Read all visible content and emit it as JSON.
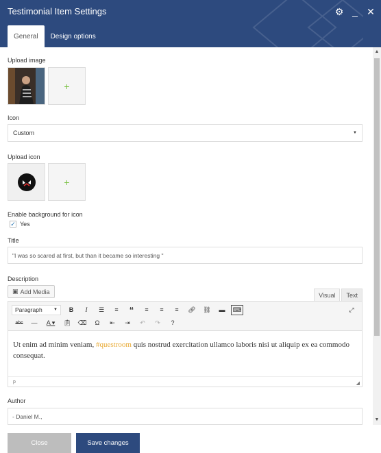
{
  "window": {
    "title": "Testimonial Item Settings"
  },
  "tabs": [
    {
      "label": "General"
    },
    {
      "label": "Design options"
    }
  ],
  "form": {
    "upload_image_label": "Upload image",
    "icon_label": "Icon",
    "icon_value": "Custom",
    "upload_icon_label": "Upload icon",
    "enable_bg_label": "Enable background for icon",
    "yes_label": "Yes",
    "title_label": "Title",
    "title_value": "\"I was so scared at first, but than it became so interesting \"",
    "description_label": "Description",
    "add_media_label": "Add Media",
    "visual_tab": "Visual",
    "text_tab": "Text",
    "paragraph_label": "Paragraph",
    "body_before": "Ut enim ad minim veniam, ",
    "body_hashtag": "#questroom",
    "body_after": " quis nostrud exercitation ullamco laboris nisi ut aliquip ex ea commodo consequat.",
    "status_path": "p",
    "author_label": "Author",
    "author_value": "- Daniel M.,"
  },
  "footer": {
    "close_label": "Close",
    "save_label": "Save changes"
  },
  "colors": {
    "header": "#2d4a7e",
    "accent_green": "#7ac143",
    "hashtag": "#e8a932"
  }
}
